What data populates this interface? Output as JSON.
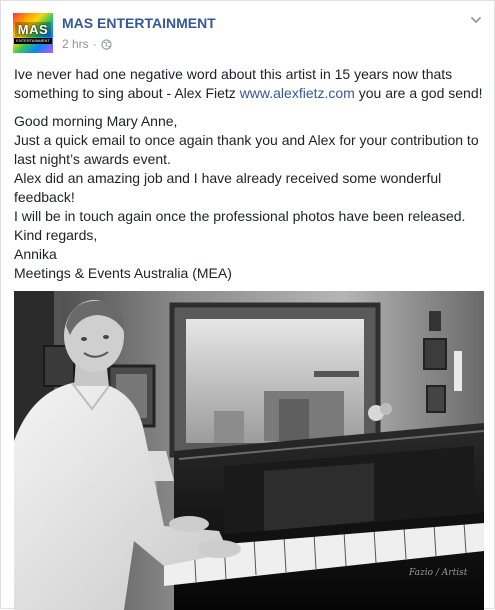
{
  "post": {
    "author": "MAS ENTERTAINMENT",
    "avatar_text": "MAS",
    "avatar_subtext": "ENTERTAINMENT",
    "timestamp": "2 hrs",
    "separator": "·",
    "privacy_icon": "globe-icon",
    "intro_before_link": "Ive never had one negative word about this artist in 15 years now thats something to sing about - Alex Fietz ",
    "link_text": "www.alexfietz.com",
    "intro_after_link": " you are a god send!",
    "body_lines": [
      "Good morning Mary Anne,",
      "Just a quick email to once again thank you and Alex for your contribution to last night’s awards event.",
      "Alex did an amazing job and I have already received some wonderful feedback!",
      "I will be in touch again once the professional photos have been released.",
      "Kind regards,",
      "Annika",
      "Meetings & Events Australia (MEA)"
    ],
    "photo_signature": "Fazio / Artist"
  },
  "colors": {
    "link": "#365899",
    "text": "#1d2129",
    "meta": "#90949c"
  }
}
